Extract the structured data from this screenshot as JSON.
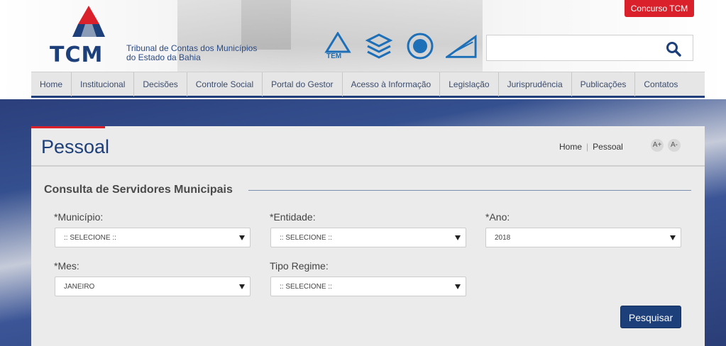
{
  "header": {
    "logo_text": "TCM",
    "logo_subtitle_line1": "Tribunal de Contas dos Municípios",
    "logo_subtitle_line2": "do Estado da Bahia",
    "concurso_label": "Concurso TCM",
    "search": {
      "value": "",
      "placeholder": ""
    },
    "partners": [
      "atem-logo",
      "escola-logo",
      "selo-logo",
      "ministerio-logo"
    ]
  },
  "nav": {
    "items": [
      "Home",
      "Institucional",
      "Decisões",
      "Controle Social",
      "Portal do Gestor",
      "Acesso à Informação",
      "Legislação",
      "Jurisprudência",
      "Publicações",
      "Contatos"
    ]
  },
  "page": {
    "title": "Pessoal",
    "breadcrumb": [
      "Home",
      "Pessoal"
    ],
    "font_increase": "A+",
    "font_decrease": "A-"
  },
  "form": {
    "section_title": "Consulta de Servidores Municipais",
    "municipio": {
      "label": "*Município:",
      "value": ":: SELECIONE ::"
    },
    "entidade": {
      "label": "*Entidade:",
      "value": ":: SELECIONE ::"
    },
    "ano": {
      "label": "*Ano:",
      "value": "2018"
    },
    "mes": {
      "label": "*Mes:",
      "value": "JANEIRO"
    },
    "tipo_regime": {
      "label": "Tipo Regime:",
      "value": ":: SELECIONE ::"
    },
    "submit_label": "Pesquisar"
  },
  "colors": {
    "brand_blue": "#1d3f7a",
    "brand_red": "#d9202b",
    "panel_bg": "#ebebeb"
  }
}
